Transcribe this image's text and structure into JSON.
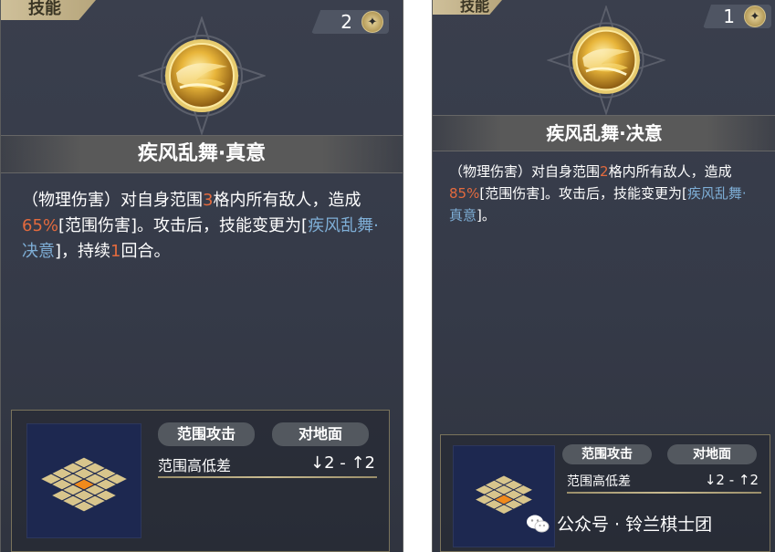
{
  "cards": [
    {
      "tag": "技能",
      "count": "2",
      "title": "疾风乱舞·真意",
      "desc": {
        "p1": "（物理伤害）对自身范围",
        "range": "3",
        "p2": "格内所有敌人，造成",
        "percent": "65%",
        "p3": "[范围伤害]。攻击后，技能变更为[",
        "skill": "疾风乱舞·决意",
        "p4": "]，持续",
        "turns": "1",
        "p5": "回合。"
      },
      "chip1": "范围攻击",
      "chip2": "对地面",
      "height_label": "范围高低差",
      "height_vals": "↓2 - ↑2"
    },
    {
      "tag": "技能",
      "count": "1",
      "title": "疾风乱舞·决意",
      "desc": {
        "p1": "（物理伤害）对自身范围",
        "range": "2",
        "p2": "格内所有敌人，造成",
        "percent": "85%",
        "p3": "[范围伤害]。攻击后，技能变更为[",
        "skill": "疾风乱舞·真意",
        "p4": "]。"
      },
      "chip1": "范围攻击",
      "chip2": "对地面",
      "height_label": "范围高低差",
      "height_vals": "↓2 - ↑2"
    }
  ],
  "watermark": "公众号 · 铃兰棋士团",
  "icons": {
    "star": "star-icon",
    "emblem": "skill-emblem-icon",
    "wechat": "wechat-icon"
  },
  "colors": {
    "highlight_orange": "#e36a3e",
    "highlight_blue": "#7eaed6",
    "tag_gold": "#cfc09a"
  }
}
